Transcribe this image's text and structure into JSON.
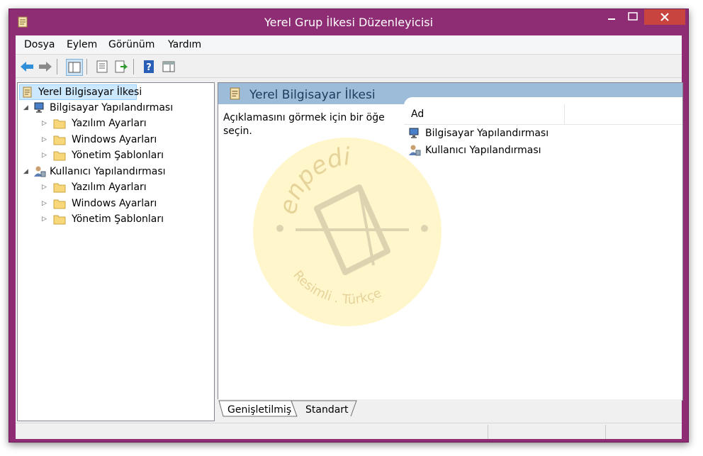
{
  "window": {
    "title": "Yerel Grup İlkesi Düzenleyicisi"
  },
  "menu": [
    "Dosya",
    "Eylem",
    "Görünüm",
    "Yardım"
  ],
  "tree": {
    "root": "Yerel Bilgisayar İlkesi",
    "computer": {
      "label": "Bilgisayar Yapılandırması",
      "children": [
        "Yazılım Ayarları",
        "Windows Ayarları",
        "Yönetim Şablonları"
      ]
    },
    "user": {
      "label": "Kullanıcı Yapılandırması",
      "children": [
        "Yazılım Ayarları",
        "Windows Ayarları",
        "Yönetim Şablonları"
      ]
    }
  },
  "right_pane": {
    "header": "Yerel Bilgisayar İlkesi",
    "description": "Açıklamasını görmek için bir öğe seçin.",
    "column_header": "Ad",
    "items": [
      "Bilgisayar Yapılandırması",
      "Kullanıcı Yapılandırması"
    ]
  },
  "tabs": [
    "Genişletilmiş",
    "Standart"
  ],
  "watermark": {
    "brand": "enpedi",
    "tagline": "Resimli . Türkçe"
  },
  "colors": {
    "titlebar": "#8e2c74",
    "close_button": "#c7443f",
    "header_band": "#9dbcd9",
    "selection": "#cce8ff"
  }
}
